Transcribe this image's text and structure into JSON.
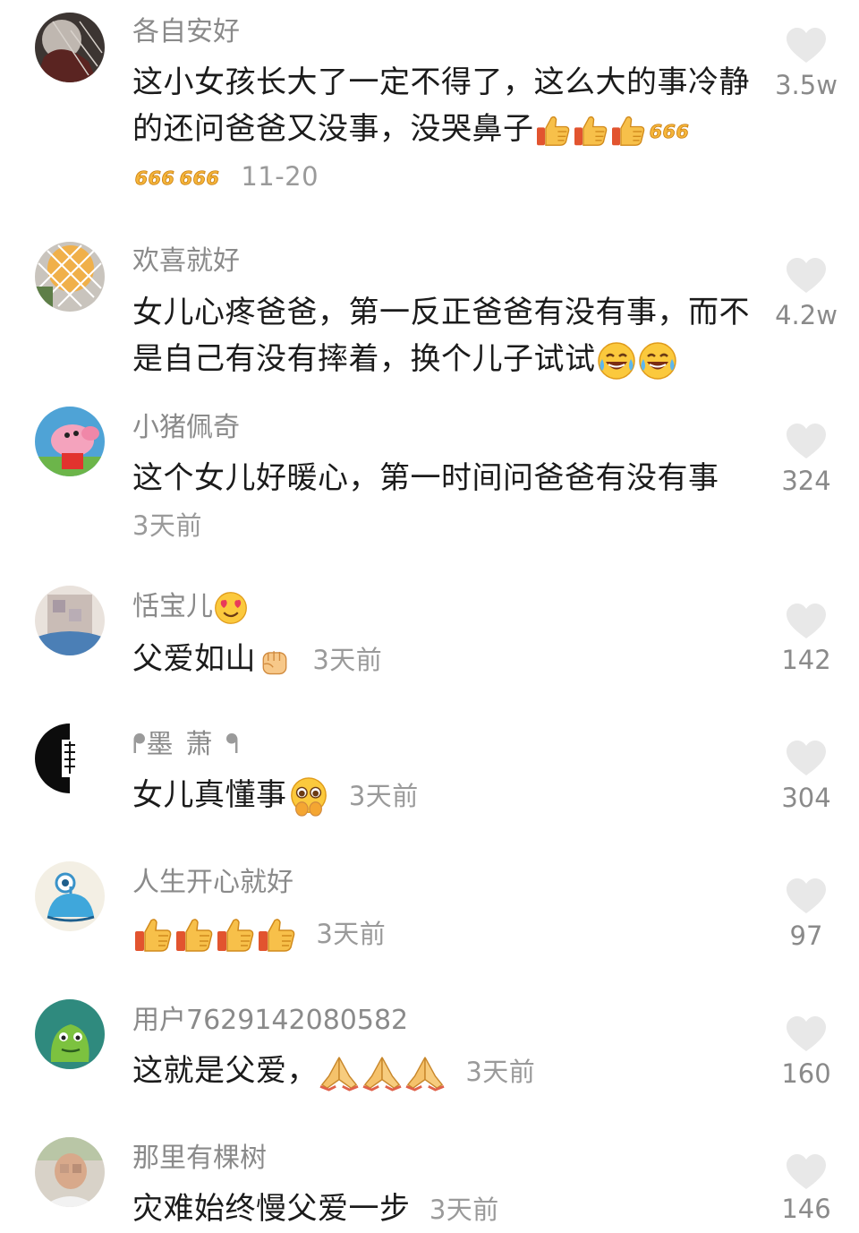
{
  "comments": [
    {
      "username": "各自安好",
      "text": "这小女孩长大了一定不得了，这么大的事冷静的还问爸爸又没事，没哭鼻子",
      "time": "11-20",
      "likes": "3.5w",
      "emojis": [
        "thumbs-up",
        "thumbs-up",
        "thumbs-up",
        "666",
        "666",
        "666"
      ]
    },
    {
      "username": "欢喜就好",
      "text": "女儿心疼爸爸，第一反正爸爸有没有事，而不是自己有没有摔着，换个儿子试试",
      "likes": "4.2w",
      "emojis": [
        "laughing-tears",
        "laughing-tears"
      ]
    },
    {
      "username": "小猪佩奇",
      "text": "这个女儿好暖心，第一时间问爸爸有没有事",
      "time": "3天前",
      "likes": "324"
    },
    {
      "username": "恬宝儿",
      "text": "父爱如山",
      "time": "3天前",
      "likes": "142",
      "emojis": [
        "heart-eyes",
        "fist"
      ]
    },
    {
      "username": "墨萧",
      "text": "女儿真懂事",
      "time": "3天前",
      "likes": "304",
      "emojis": [
        "pleading-face"
      ]
    },
    {
      "username": "人生开心就好",
      "text": "",
      "time": "3天前",
      "likes": "97",
      "emojis": [
        "thumbs-up",
        "thumbs-up",
        "thumbs-up",
        "thumbs-up"
      ]
    },
    {
      "username": "用户7629142080582",
      "text": "这就是父爱，",
      "time": "3天前",
      "likes": "160",
      "emojis": [
        "praying-hands",
        "praying-hands",
        "praying-hands"
      ]
    },
    {
      "username": "那里有棵树",
      "text": "灾难始终慢父爱一步",
      "time": "3天前",
      "likes": "146"
    }
  ],
  "colors": {
    "heart": "#e8e8e8",
    "username": "#8a8a8a",
    "text": "#1b1b1b",
    "meta": "#9a9a9a"
  }
}
